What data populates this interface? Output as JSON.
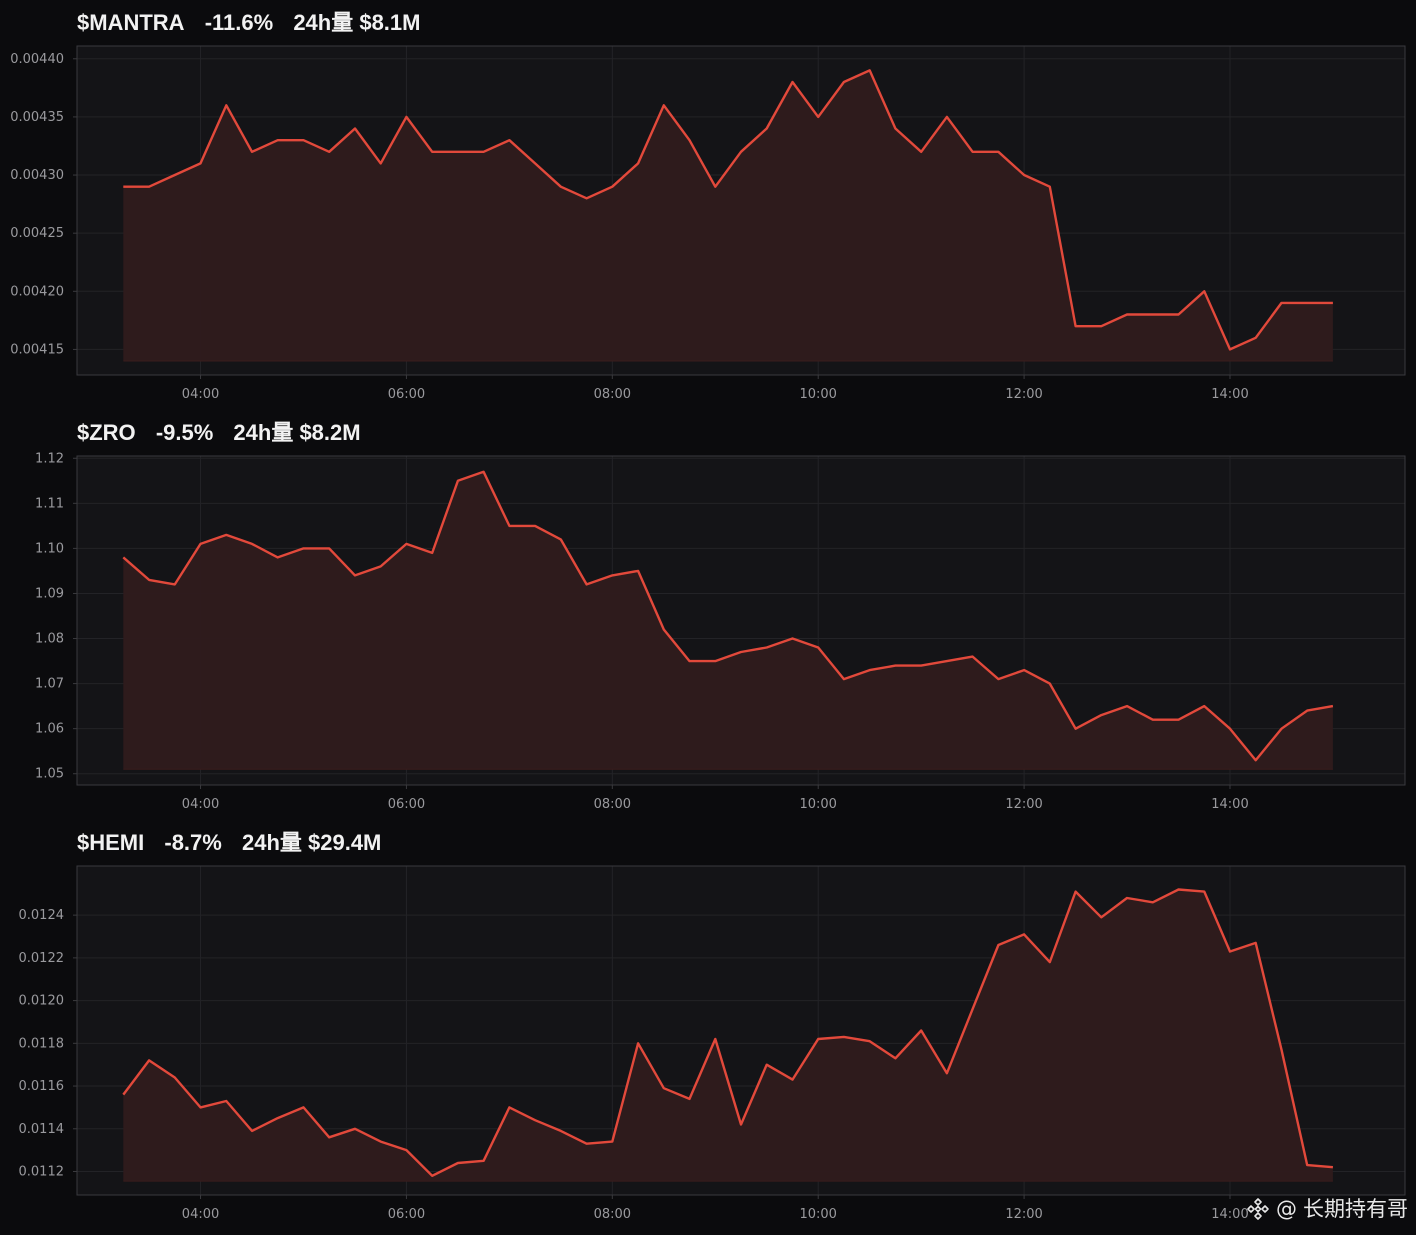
{
  "style": {
    "background": "#0b0b0d",
    "plot_background": "#141417",
    "frame_color": "#3a3a3e",
    "grid_color": "#232327",
    "tick_color": "#9a9a9e",
    "line_color": "#e2493b",
    "fill_color": "#2f1b1c"
  },
  "watermark": {
    "at_label": "@",
    "author": "长期持有哥",
    "logo_icon": "binance-square-icon"
  },
  "chart_data": [
    {
      "type": "area",
      "ticker": "$MANTRA",
      "change": "-11.6%",
      "volume": "24h量 $8.1M",
      "x_unit": "hour_of_day",
      "xlim": [
        2.8,
        15.7
      ],
      "xticks": [
        4,
        6,
        8,
        10,
        12,
        14
      ],
      "xtick_labels": [
        "04:00",
        "06:00",
        "08:00",
        "10:00",
        "12:00",
        "14:00"
      ],
      "ylim": [
        0.004128,
        0.004411
      ],
      "yticks": [
        0.00415,
        0.0042,
        0.00425,
        0.0043,
        0.00435,
        0.0044
      ],
      "ytick_labels": [
        "0.00415",
        "0.00420",
        "0.00425",
        "0.00430",
        "0.00435",
        "0.00440"
      ],
      "fill_base": 0.00414,
      "grid": true,
      "x": [
        3.25,
        3.5,
        3.75,
        4.0,
        4.25,
        4.5,
        4.75,
        5.0,
        5.25,
        5.5,
        5.75,
        6.0,
        6.25,
        6.5,
        6.75,
        7.0,
        7.25,
        7.5,
        7.75,
        8.0,
        8.25,
        8.5,
        8.75,
        9.0,
        9.25,
        9.5,
        9.75,
        10.0,
        10.25,
        10.5,
        10.75,
        11.0,
        11.25,
        11.5,
        11.75,
        12.0,
        12.25,
        12.5,
        12.75,
        13.0,
        13.25,
        13.5,
        13.75,
        14.0,
        14.25,
        14.5,
        14.75,
        15.0
      ],
      "y": [
        0.00429,
        0.00429,
        0.0043,
        0.00431,
        0.00436,
        0.00432,
        0.00433,
        0.00433,
        0.00432,
        0.00434,
        0.00431,
        0.00435,
        0.00432,
        0.00432,
        0.00432,
        0.00433,
        0.00431,
        0.00429,
        0.00428,
        0.00429,
        0.00431,
        0.00436,
        0.00433,
        0.00429,
        0.00432,
        0.00434,
        0.00438,
        0.00435,
        0.00438,
        0.00439,
        0.00434,
        0.00432,
        0.00435,
        0.00432,
        0.00432,
        0.0043,
        0.00429,
        0.00417,
        0.00417,
        0.00418,
        0.00418,
        0.00418,
        0.0042,
        0.00415,
        0.00416,
        0.00419,
        0.00419,
        0.00419
      ]
    },
    {
      "type": "area",
      "ticker": "$ZRO",
      "change": "-9.5%",
      "volume": "24h量 $8.2M",
      "x_unit": "hour_of_day",
      "xlim": [
        2.8,
        15.7
      ],
      "xticks": [
        4,
        6,
        8,
        10,
        12,
        14
      ],
      "xtick_labels": [
        "04:00",
        "06:00",
        "08:00",
        "10:00",
        "12:00",
        "14:00"
      ],
      "ylim": [
        1.0475,
        1.1205
      ],
      "yticks": [
        1.05,
        1.06,
        1.07,
        1.08,
        1.09,
        1.1,
        1.11,
        1.12
      ],
      "ytick_labels": [
        "1.05",
        "1.06",
        "1.07",
        "1.08",
        "1.09",
        "1.10",
        "1.11",
        "1.12"
      ],
      "fill_base": 1.051,
      "grid": true,
      "x": [
        3.25,
        3.5,
        3.75,
        4.0,
        4.25,
        4.5,
        4.75,
        5.0,
        5.25,
        5.5,
        5.75,
        6.0,
        6.25,
        6.5,
        6.75,
        7.0,
        7.25,
        7.5,
        7.75,
        8.0,
        8.25,
        8.5,
        8.75,
        9.0,
        9.25,
        9.5,
        9.75,
        10.0,
        10.25,
        10.5,
        10.75,
        11.0,
        11.25,
        11.5,
        11.75,
        12.0,
        12.25,
        12.5,
        12.75,
        13.0,
        13.25,
        13.5,
        13.75,
        14.0,
        14.25,
        14.5,
        14.75,
        15.0
      ],
      "y": [
        1.098,
        1.093,
        1.092,
        1.101,
        1.103,
        1.101,
        1.098,
        1.1,
        1.1,
        1.094,
        1.096,
        1.101,
        1.099,
        1.115,
        1.117,
        1.105,
        1.105,
        1.102,
        1.092,
        1.094,
        1.095,
        1.082,
        1.075,
        1.075,
        1.077,
        1.078,
        1.08,
        1.078,
        1.071,
        1.073,
        1.074,
        1.074,
        1.075,
        1.076,
        1.071,
        1.073,
        1.07,
        1.06,
        1.063,
        1.065,
        1.062,
        1.062,
        1.065,
        1.06,
        1.053,
        1.06,
        1.064,
        1.065
      ]
    },
    {
      "type": "area",
      "ticker": "$HEMI",
      "change": "-8.7%",
      "volume": "24h量 $29.4M",
      "x_unit": "hour_of_day",
      "xlim": [
        2.8,
        15.7
      ],
      "xticks": [
        4,
        6,
        8,
        10,
        12,
        14
      ],
      "xtick_labels": [
        "04:00",
        "06:00",
        "08:00",
        "10:00",
        "12:00",
        "14:00"
      ],
      "ylim": [
        0.01109,
        0.01263
      ],
      "yticks": [
        0.0112,
        0.0114,
        0.0116,
        0.0118,
        0.012,
        0.0122,
        0.0124
      ],
      "ytick_labels": [
        "0.0112",
        "0.0114",
        "0.0116",
        "0.0118",
        "0.0120",
        "0.0122",
        "0.0124"
      ],
      "fill_base": 0.011155,
      "grid": true,
      "x": [
        3.25,
        3.5,
        3.75,
        4.0,
        4.25,
        4.5,
        4.75,
        5.0,
        5.25,
        5.5,
        5.75,
        6.0,
        6.25,
        6.5,
        6.75,
        7.0,
        7.25,
        7.5,
        7.75,
        8.0,
        8.25,
        8.5,
        8.75,
        9.0,
        9.25,
        9.5,
        9.75,
        10.0,
        10.25,
        10.5,
        10.75,
        11.0,
        11.25,
        11.5,
        11.75,
        12.0,
        12.25,
        12.5,
        12.75,
        13.0,
        13.25,
        13.5,
        13.75,
        14.0,
        14.25,
        14.5,
        14.75,
        15.0
      ],
      "y": [
        0.01156,
        0.01172,
        0.01164,
        0.0115,
        0.01153,
        0.01139,
        0.01145,
        0.0115,
        0.01136,
        0.0114,
        0.01134,
        0.0113,
        0.01118,
        0.01124,
        0.01125,
        0.0115,
        0.01144,
        0.01139,
        0.01133,
        0.01134,
        0.0118,
        0.01159,
        0.01154,
        0.01182,
        0.01142,
        0.0117,
        0.01163,
        0.01182,
        0.01183,
        0.01181,
        0.01173,
        0.01186,
        0.01166,
        0.01196,
        0.01226,
        0.01231,
        0.01218,
        0.01251,
        0.01239,
        0.01248,
        0.01246,
        0.01252,
        0.01251,
        0.01223,
        0.01227,
        0.01177,
        0.01123,
        0.01122
      ]
    }
  ]
}
